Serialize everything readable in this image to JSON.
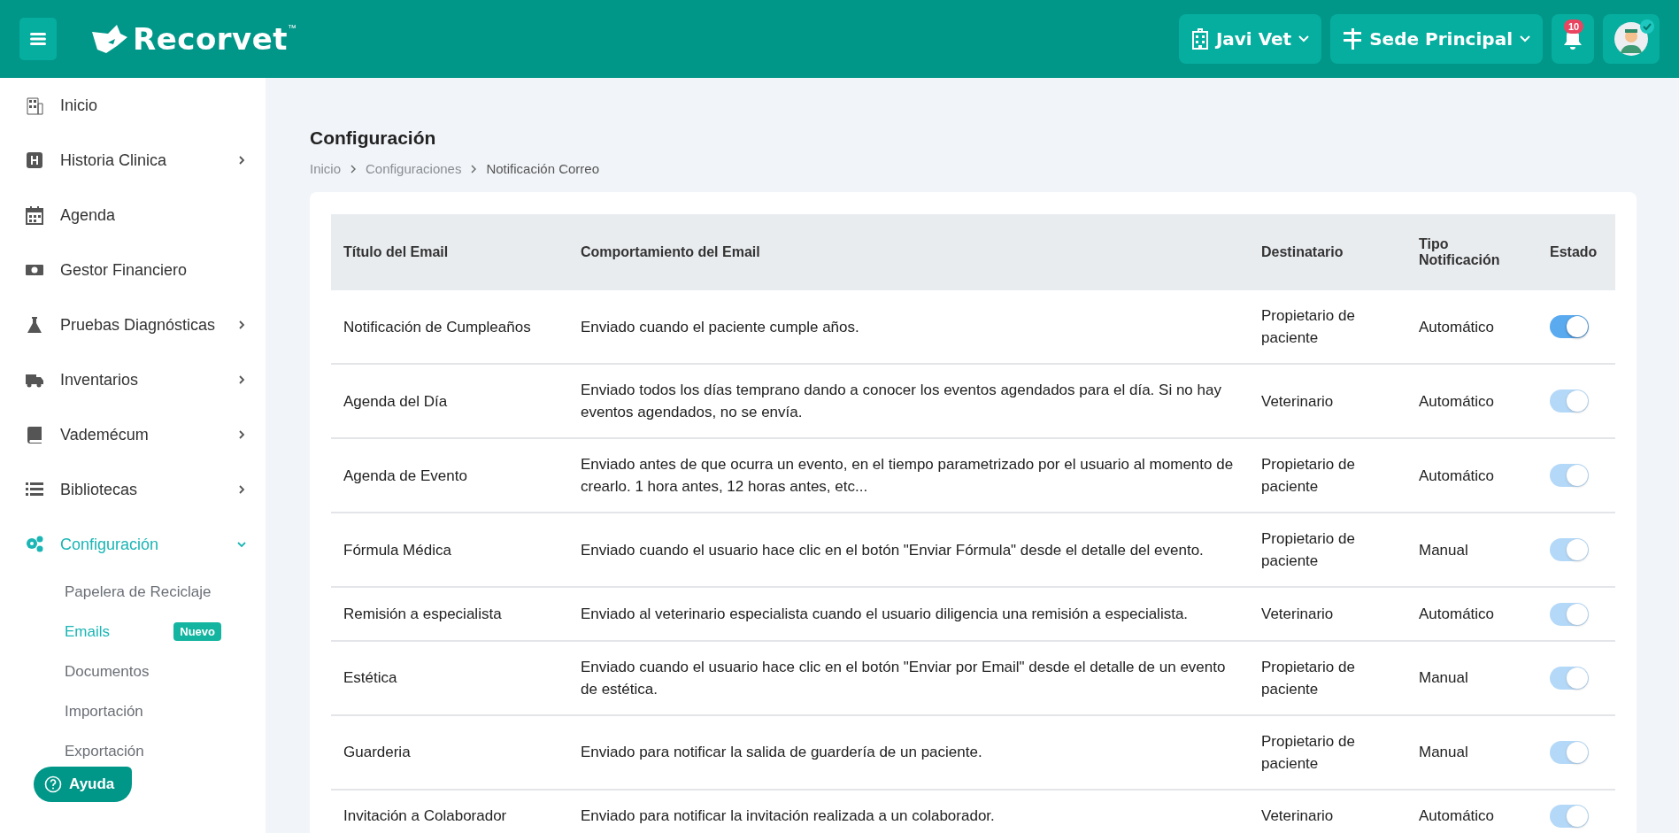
{
  "topbar": {
    "logo": "Recorvet",
    "trademark": "™",
    "clinic": "Javi Vet",
    "branch": "Sede Principal",
    "notifications": "10"
  },
  "sidebar": {
    "items": [
      {
        "kind": "building",
        "label": "Inicio",
        "has_children": false,
        "selected": false
      },
      {
        "kind": "hospital",
        "label": "Historia Clinica",
        "has_children": true,
        "selected": false
      },
      {
        "kind": "calendar",
        "label": "Agenda",
        "has_children": false,
        "selected": false
      },
      {
        "kind": "money",
        "label": "Gestor Financiero",
        "has_children": false,
        "selected": false
      },
      {
        "kind": "flask",
        "label": "Pruebas Diagnósticas",
        "has_children": true,
        "selected": false
      },
      {
        "kind": "truck",
        "label": "Inventarios",
        "has_children": true,
        "selected": false
      },
      {
        "kind": "book",
        "label": "Vademécum",
        "has_children": true,
        "selected": false
      },
      {
        "kind": "list",
        "label": "Bibliotecas",
        "has_children": true,
        "selected": false
      },
      {
        "kind": "gears",
        "label": "Configuración",
        "has_children": true,
        "selected": true,
        "expanded": true,
        "children": [
          {
            "label": "Papelera de Reciclaje",
            "selected": false
          },
          {
            "label": "Emails",
            "selected": true,
            "badge": "Nuevo"
          },
          {
            "label": "Documentos",
            "selected": false
          },
          {
            "label": "Importación",
            "selected": false
          },
          {
            "label": "Exportación",
            "selected": false
          }
        ]
      }
    ]
  },
  "help_button": "Ayuda",
  "page": {
    "title": "Configuración",
    "breadcrumb": [
      "Inicio",
      "Configuraciones",
      "Notificación Correo"
    ]
  },
  "table": {
    "columns": [
      "Título del Email",
      "Comportamiento del Email",
      "Destinatario",
      "Tipo Notificación",
      "Estado"
    ],
    "rows": [
      {
        "title": "Notificación de Cumpleaños",
        "behavior": "Enviado cuando el paciente cumple años.",
        "recipient": "Propietario de paciente",
        "type": "Automático",
        "on": true,
        "disabled": false
      },
      {
        "title": "Agenda del Día",
        "behavior": "Enviado todos los días temprano dando a conocer los eventos agendados para el día. Si no hay eventos agendados, no se envía.",
        "recipient": "Veterinario",
        "type": "Automático",
        "on": true,
        "disabled": true
      },
      {
        "title": "Agenda de Evento",
        "behavior": "Enviado antes de que ocurra un evento, en el tiempo parametrizado por el usuario al momento de crearlo. 1 hora antes, 12 horas antes, etc...",
        "recipient": "Propietario de paciente",
        "type": "Automático",
        "on": true,
        "disabled": true
      },
      {
        "title": "Fórmula Médica",
        "behavior": "Enviado cuando el usuario hace clic en el botón \"Enviar Fórmula\" desde el detalle del evento.",
        "recipient": "Propietario de paciente",
        "type": "Manual",
        "on": true,
        "disabled": true
      },
      {
        "title": "Remisión a especialista",
        "behavior": "Enviado al veterinario especialista cuando el usuario diligencia una remisión a especialista.",
        "recipient": "Veterinario",
        "type": "Automático",
        "on": true,
        "disabled": true
      },
      {
        "title": "Estética",
        "behavior": "Enviado cuando el usuario hace clic en el botón \"Enviar por Email\" desde el detalle de un evento de estética.",
        "recipient": "Propietario de paciente",
        "type": "Manual",
        "on": true,
        "disabled": true
      },
      {
        "title": "Guarderia",
        "behavior": "Enviado para notificar la salida de guardería de un paciente.",
        "recipient": "Propietario de paciente",
        "type": "Manual",
        "on": true,
        "disabled": true
      },
      {
        "title": "Invitación a Colaborador",
        "behavior": "Enviado para notificar la invitación realizada a un colaborador.",
        "recipient": "Veterinario",
        "type": "Automático",
        "on": true,
        "disabled": true
      }
    ]
  }
}
